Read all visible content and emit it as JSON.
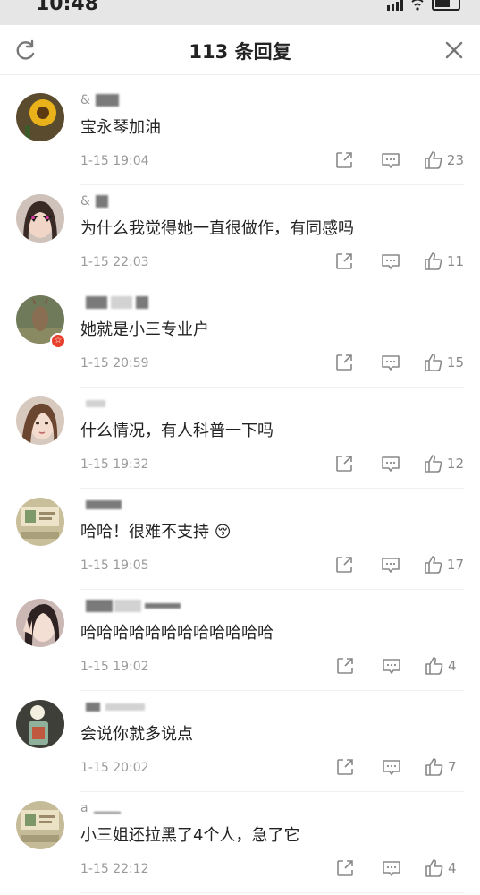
{
  "status_bar": {
    "time": "10:48"
  },
  "header": {
    "title": "113 条回复",
    "refresh_icon": "refresh-icon",
    "close_icon": "close-icon"
  },
  "colors": {
    "text": "#222222",
    "meta": "#9a9a9a",
    "badge": "#e8402c"
  },
  "comments": [
    {
      "user": "&",
      "text": "宝永琴加油",
      "time": "1-15 19:04",
      "likes": "23",
      "avatar": "sunflower"
    },
    {
      "user": "&",
      "text": "为什么我觉得她一直很做作，有同感吗",
      "time": "1-15 22:03",
      "likes": "11",
      "avatar": "girl-sunglasses"
    },
    {
      "user": "",
      "text": "她就是小三专业户",
      "time": "1-15 20:59",
      "likes": "15",
      "avatar": "kangaroo",
      "badge": "☆"
    },
    {
      "user": "",
      "text": "什么情况，有人科普一下吗",
      "time": "1-15 19:32",
      "likes": "12",
      "avatar": "girl-portrait"
    },
    {
      "user": "",
      "text": "哈哈！很难不支持 😚",
      "time": "1-15 19:05",
      "likes": "17",
      "avatar": "screenshot-a"
    },
    {
      "user": "",
      "text": "哈哈哈哈哈哈哈哈哈哈哈哈",
      "time": "1-15 19:02",
      "likes": "4",
      "avatar": "girl-peace"
    },
    {
      "user": "",
      "text": "会说你就多说点",
      "time": "1-15 20:02",
      "likes": "7",
      "avatar": "flower-jar"
    },
    {
      "user": "a",
      "text": "小三姐还拉黑了4个人，急了它",
      "time": "1-15 22:12",
      "likes": "4",
      "avatar": "screenshot-b"
    }
  ]
}
